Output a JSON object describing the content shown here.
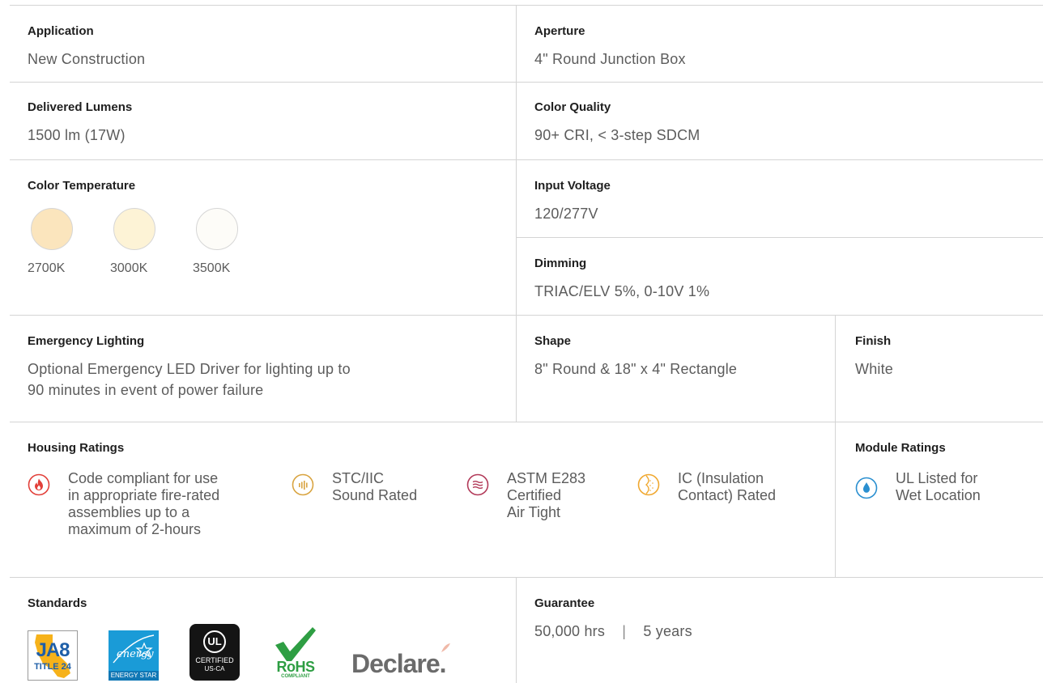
{
  "application": {
    "label": "Application",
    "value": "New Construction"
  },
  "aperture": {
    "label": "Aperture",
    "value": "4\" Round Junction Box"
  },
  "delivered_lumens": {
    "label": "Delivered Lumens",
    "value": "1500 lm (17W)"
  },
  "color_quality": {
    "label": "Color Quality",
    "value": "90+ CRI, < 3-step SDCM"
  },
  "color_temperature": {
    "label": "Color Temperature",
    "swatches": [
      {
        "label": "2700K",
        "color": "#fbe5bd"
      },
      {
        "label": "3000K",
        "color": "#fdf3d6"
      },
      {
        "label": "3500K",
        "color": "#fdfcf8"
      }
    ]
  },
  "input_voltage": {
    "label": "Input Voltage",
    "value": "120/277V"
  },
  "dimming": {
    "label": "Dimming",
    "value": "TRIAC/ELV 5%, 0-10V 1%"
  },
  "emergency_lighting": {
    "label": "Emergency Lighting",
    "lines": [
      "Optional Emergency LED Driver for lighting up to",
      "90 minutes in event of power failure"
    ]
  },
  "shape": {
    "label": "Shape",
    "value": "8\" Round & 18\" x 4\" Rectangle"
  },
  "finish": {
    "label": "Finish",
    "value": "White"
  },
  "housing_ratings": {
    "label": "Housing Ratings",
    "items": [
      {
        "icon": "fire-icon",
        "color": "#e2403a",
        "lines": [
          "Code compliant for use",
          "in appropriate fire-rated",
          "assemblies up to a",
          "maximum of 2-hours"
        ]
      },
      {
        "icon": "sound-icon",
        "color": "#d9a441",
        "lines": [
          "STC/IIC",
          "Sound Rated"
        ]
      },
      {
        "icon": "air-icon",
        "color": "#b23a59",
        "lines": [
          "ASTM E283",
          "Certified",
          "Air Tight"
        ]
      },
      {
        "icon": "insulation-icon",
        "color": "#f0a830",
        "lines": [
          "IC (Insulation",
          "Contact) Rated"
        ]
      }
    ]
  },
  "module_ratings": {
    "label": "Module Ratings",
    "items": [
      {
        "icon": "water-drop-icon",
        "color": "#2a8fd0",
        "lines": [
          "UL Listed for",
          "Wet Location"
        ]
      }
    ]
  },
  "standards": {
    "label": "Standards",
    "logos": [
      {
        "icon": "ja8-title24-logo",
        "text": "JA8",
        "subtext": "TITLE 24"
      },
      {
        "icon": "energy-star-logo",
        "text": "energy",
        "subtext": "ENERGY STAR"
      },
      {
        "icon": "ul-certified-logo",
        "text": "UL",
        "subtext": "CERTIFIED",
        "subtext2": "US-CA"
      },
      {
        "icon": "rohs-logo",
        "text": "RoHS",
        "subtext": "COMPLIANT"
      },
      {
        "icon": "declare-logo",
        "text": "Declare."
      }
    ]
  },
  "guarantee": {
    "label": "Guarantee",
    "hours": "50,000 hrs",
    "separator": "|",
    "years": "5 years"
  }
}
